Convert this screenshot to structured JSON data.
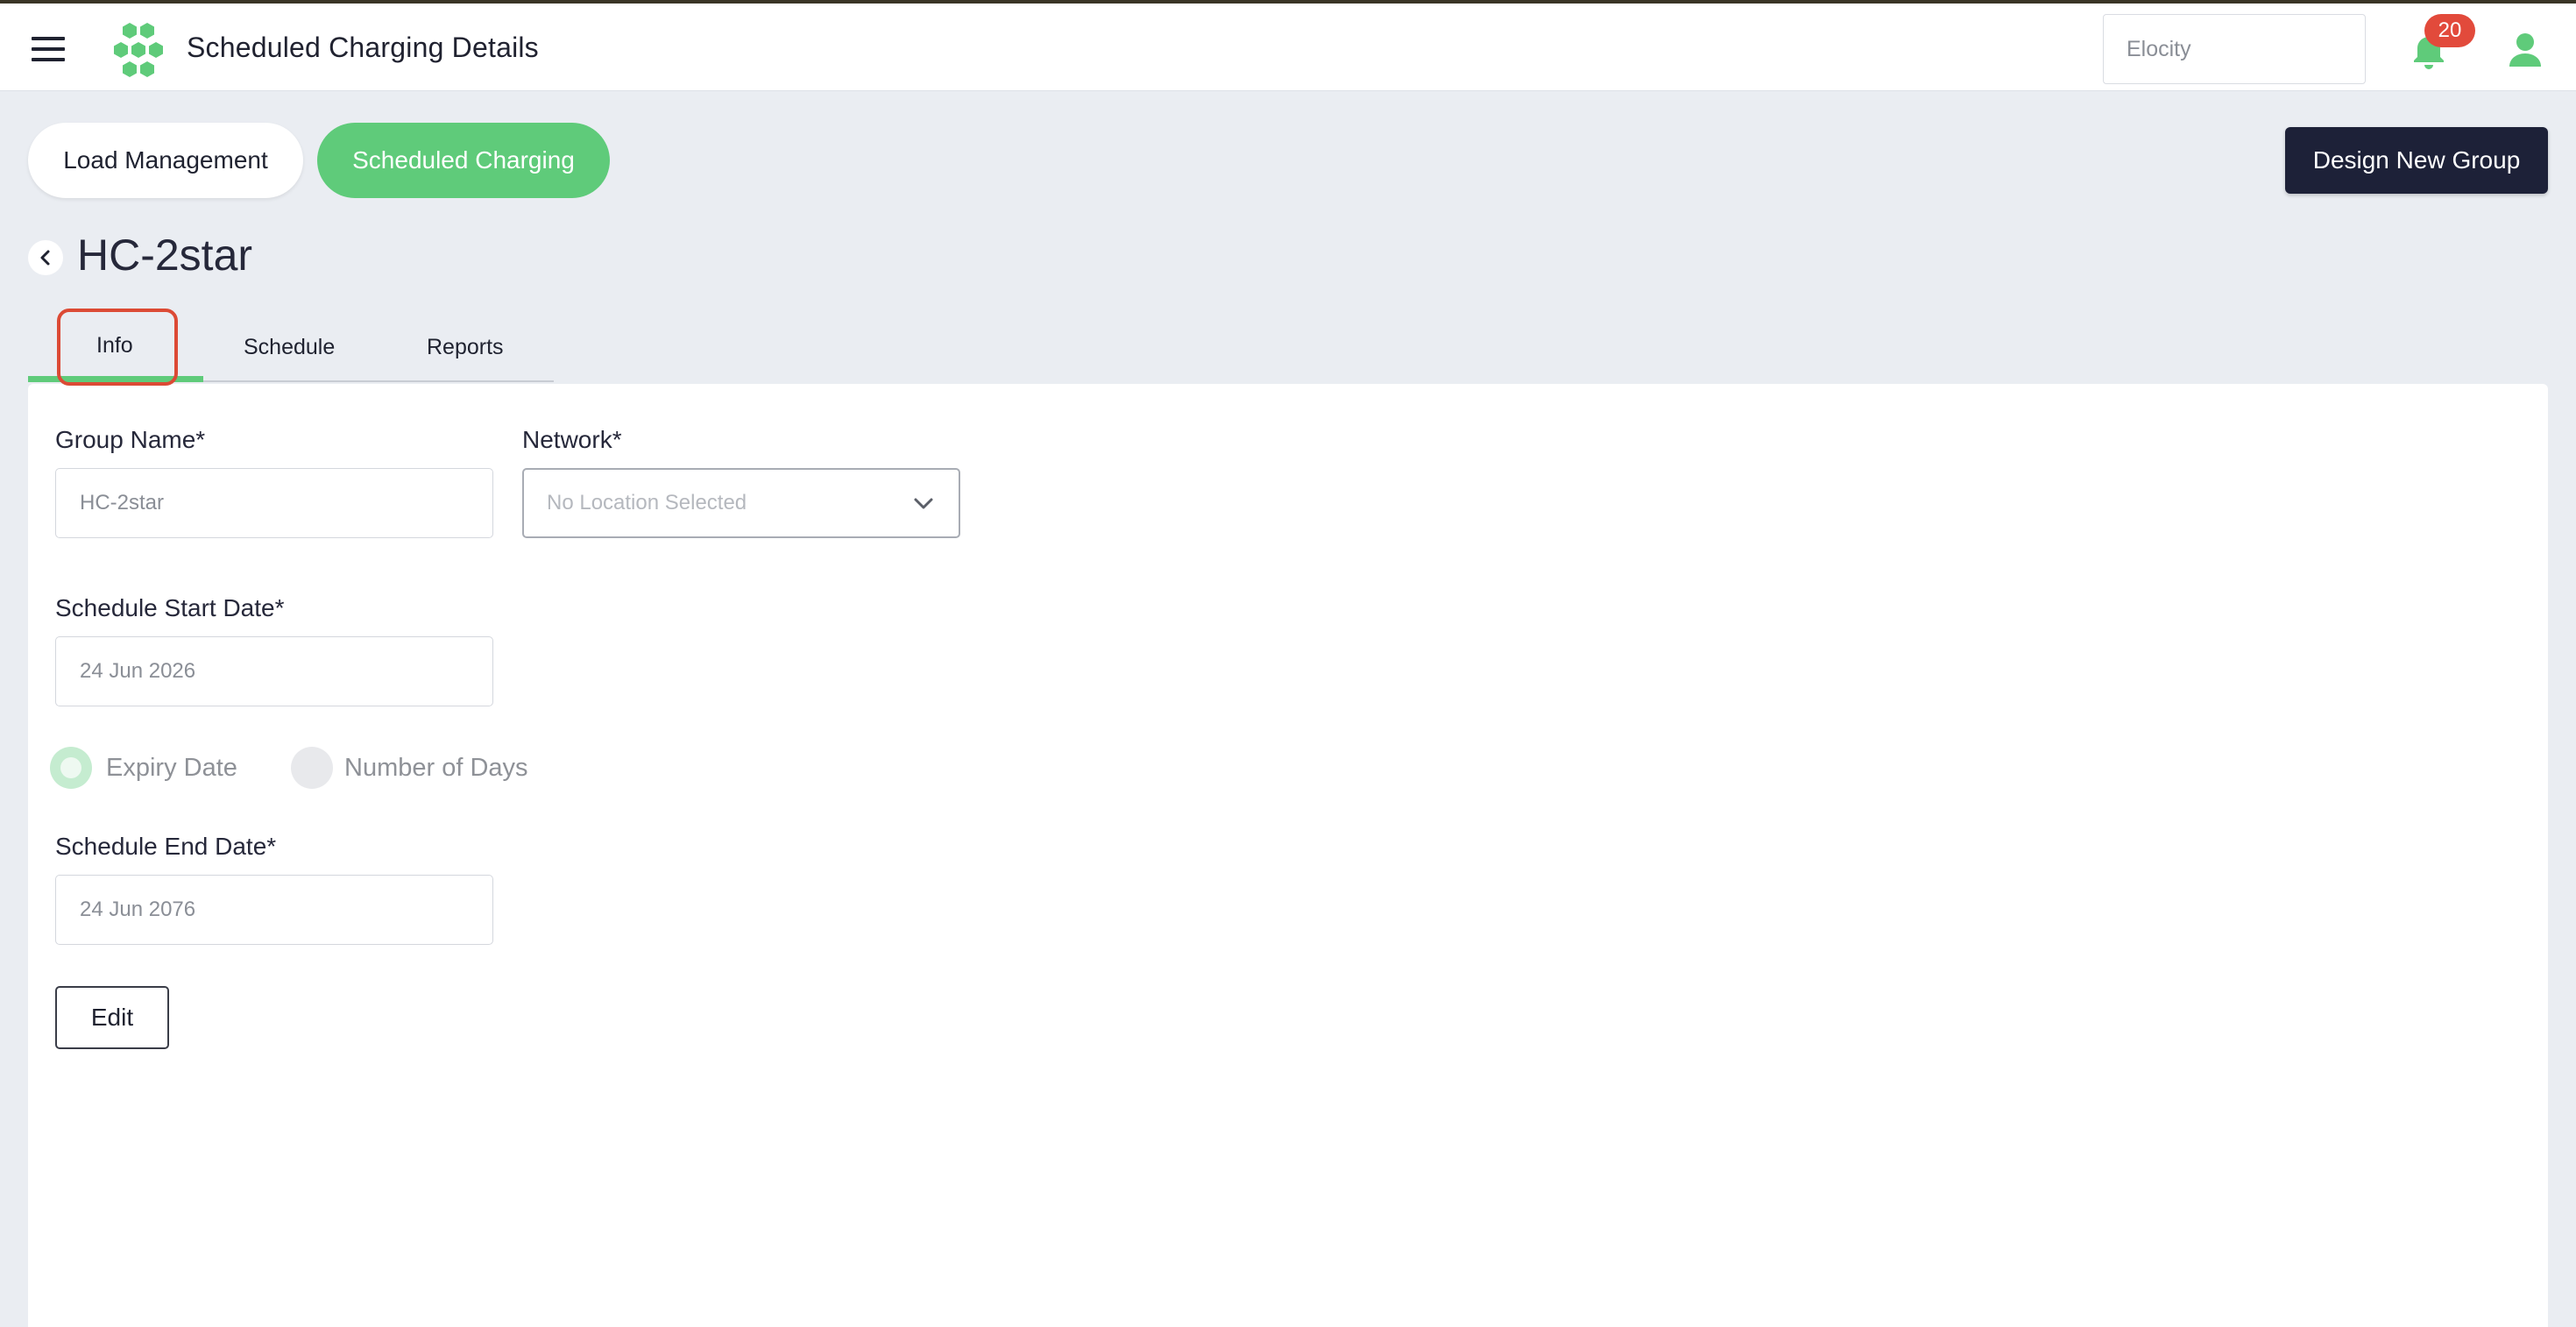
{
  "header": {
    "title": "Scheduled Charging Details",
    "org_search_placeholder": "Elocity",
    "notification_count": "20",
    "icons": [
      "menu-icon",
      "logo-icon",
      "bell-icon",
      "user-icon"
    ]
  },
  "nav_pills": [
    {
      "label": "Load Management",
      "active": false
    },
    {
      "label": "Scheduled Charging",
      "active": true
    }
  ],
  "actions": {
    "design_new_group": "Design New Group"
  },
  "group": {
    "title": "HC-2star"
  },
  "tabs": [
    {
      "label": "Info",
      "active": true
    },
    {
      "label": "Schedule",
      "active": false
    },
    {
      "label": "Reports",
      "active": false
    }
  ],
  "form": {
    "group_name_label": "Group Name*",
    "group_name_value": "HC-2star",
    "network_label": "Network*",
    "network_value": "No Location Selected",
    "start_date_label": "Schedule Start Date*",
    "start_date_value": "24 Jun 2026",
    "radio_options": [
      {
        "label": "Expiry Date",
        "selected": true
      },
      {
        "label": "Number of Days",
        "selected": false
      }
    ],
    "end_date_label": "Schedule End Date*",
    "end_date_value": "24 Jun 2076",
    "edit_label": "Edit"
  },
  "colors": {
    "accent_green": "#5fcb7a",
    "dark_navy": "#1d2138",
    "badge_red": "#e24a3b",
    "highlight_red": "#dc4a35",
    "page_bg": "#eaedf2"
  }
}
